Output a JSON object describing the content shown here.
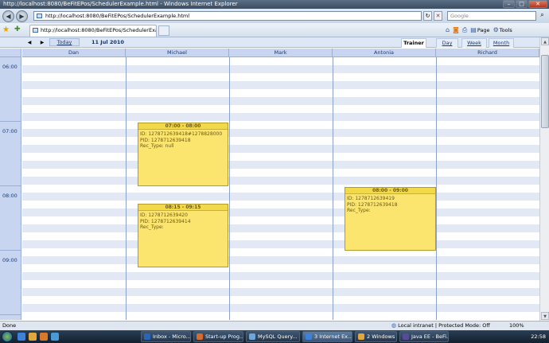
{
  "window": {
    "title": "http://localhost:8080/BeFitEPos/SchedulerExample.html - Windows Internet Explorer",
    "min": "–",
    "max": "□",
    "close": "✕"
  },
  "address": {
    "url": "http://localhost:8080/BeFitEPos/SchedulerExample.html",
    "search_placeholder": "Google"
  },
  "tab": {
    "title": "http://localhost:8080/BeFitEPos/SchedulerExamp..."
  },
  "commands": {
    "page": "Page",
    "tools": "Tools"
  },
  "scheduler": {
    "today": "Today",
    "date": "11 Jul 2010",
    "prev": "◀",
    "next": "▶",
    "views": {
      "trainer": "Trainer",
      "day": "Day",
      "week": "Week",
      "month": "Month"
    },
    "columns": [
      "Dan",
      "Michael",
      "Mark",
      "Antonia",
      "Richard"
    ],
    "hours": [
      "06:00",
      "07:00",
      "08:00",
      "09:00"
    ],
    "appointments": [
      {
        "header": "07:00 - 08:00",
        "line1": "ID: 1278712639418#1278828000",
        "line2": "PID: 1278712639418",
        "line3": "Rec_Type: null"
      },
      {
        "header": "08:15 - 09:15",
        "line1": "ID: 1278712639420",
        "line2": "PID: 1278712639414",
        "line3": "Rec_Type:"
      },
      {
        "header": "08:00 - 09:00",
        "line1": "ID: 1278712639419",
        "line2": "PID: 1278712639418",
        "line3": "Rec_Type:"
      }
    ]
  },
  "status": {
    "done": "Done",
    "zone": "Local intranet | Protected Mode: Off",
    "zoom": "100%"
  },
  "taskbar": {
    "items": [
      "Inbox - Micro...",
      "Start-up Prog...",
      "MySQL Query...",
      "3 Internet Ex...",
      "2 Windows ...",
      "Java EE - BeFi..."
    ],
    "time": "22:58"
  }
}
